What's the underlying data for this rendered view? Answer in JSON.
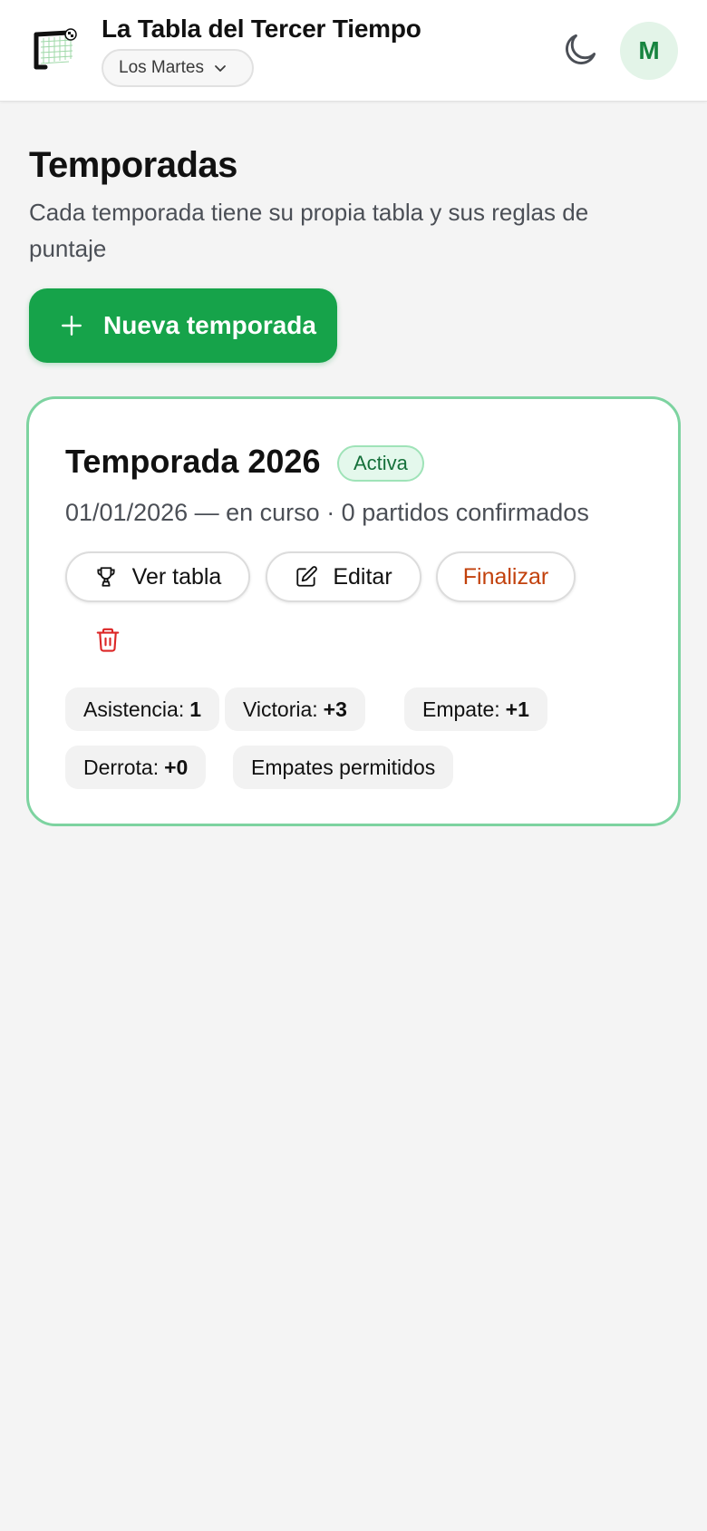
{
  "header": {
    "app_title": "La Tabla del Tercer Tiempo",
    "group_selected": "Los Martes",
    "avatar_initial": "M"
  },
  "page": {
    "title": "Temporadas",
    "subtitle": "Cada temporada tiene su propia tabla y sus reglas de puntaje",
    "new_button_label": "Nueva temporada"
  },
  "season": {
    "name": "Temporada 2026",
    "status": "Activa",
    "meta": "01/01/2026 — en curso · 0 partidos confirmados",
    "actions": {
      "view_table": "Ver tabla",
      "edit": "Editar",
      "finish": "Finalizar"
    },
    "rules": [
      {
        "label": "Asistencia:",
        "value": "1"
      },
      {
        "label": "Victoria:",
        "value": "+3"
      },
      {
        "label": "Empate:",
        "value": "+1"
      },
      {
        "label": "Derrota:",
        "value": "+0"
      },
      {
        "label": "Empates permitidos",
        "value": ""
      }
    ]
  },
  "colors": {
    "accent": "#16a34a",
    "card_border": "#7dd3a0",
    "finish_text": "#c2410c",
    "delete_icon": "#dc2626"
  }
}
